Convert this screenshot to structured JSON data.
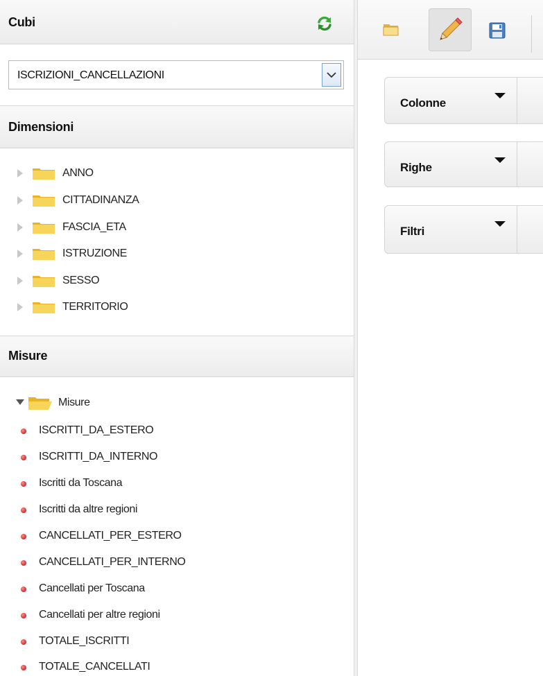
{
  "left_panel": {
    "cubes_header": "Cubi",
    "cube_select": {
      "value": "ISCRIZIONI_CANCELLAZIONI"
    },
    "dimensions_header": "Dimensioni",
    "dimensions": [
      {
        "label": "ANNO"
      },
      {
        "label": "CITTADINANZA"
      },
      {
        "label": "FASCIA_ETA"
      },
      {
        "label": "ISTRUZIONE"
      },
      {
        "label": "SESSO"
      },
      {
        "label": "TERRITORIO"
      }
    ],
    "measures_header": "Misure",
    "measures_folder": "Misure",
    "measures": [
      {
        "label": "ISCRITTI_DA_ESTERO"
      },
      {
        "label": "ISCRITTI_DA_INTERNO"
      },
      {
        "label": "Iscritti da Toscana"
      },
      {
        "label": "Iscritti da altre regioni"
      },
      {
        "label": "CANCELLATI_PER_ESTERO"
      },
      {
        "label": "CANCELLATI_PER_INTERNO"
      },
      {
        "label": "Cancellati per Toscana"
      },
      {
        "label": "Cancellati per altre regioni"
      },
      {
        "label": "TOTALE_ISCRITTI"
      },
      {
        "label": "TOTALE_CANCELLATI"
      }
    ]
  },
  "workspace": {
    "toolbar": [
      "folder-open-icon",
      "pencil-icon",
      "save-icon"
    ],
    "drop_zones": [
      {
        "label": "Colonne"
      },
      {
        "label": "Righe"
      },
      {
        "label": "Filtri"
      }
    ]
  },
  "colors": {
    "measure_dot": "#d42a2a",
    "refresh": "#3aa93a",
    "folder": "#f2c230"
  }
}
